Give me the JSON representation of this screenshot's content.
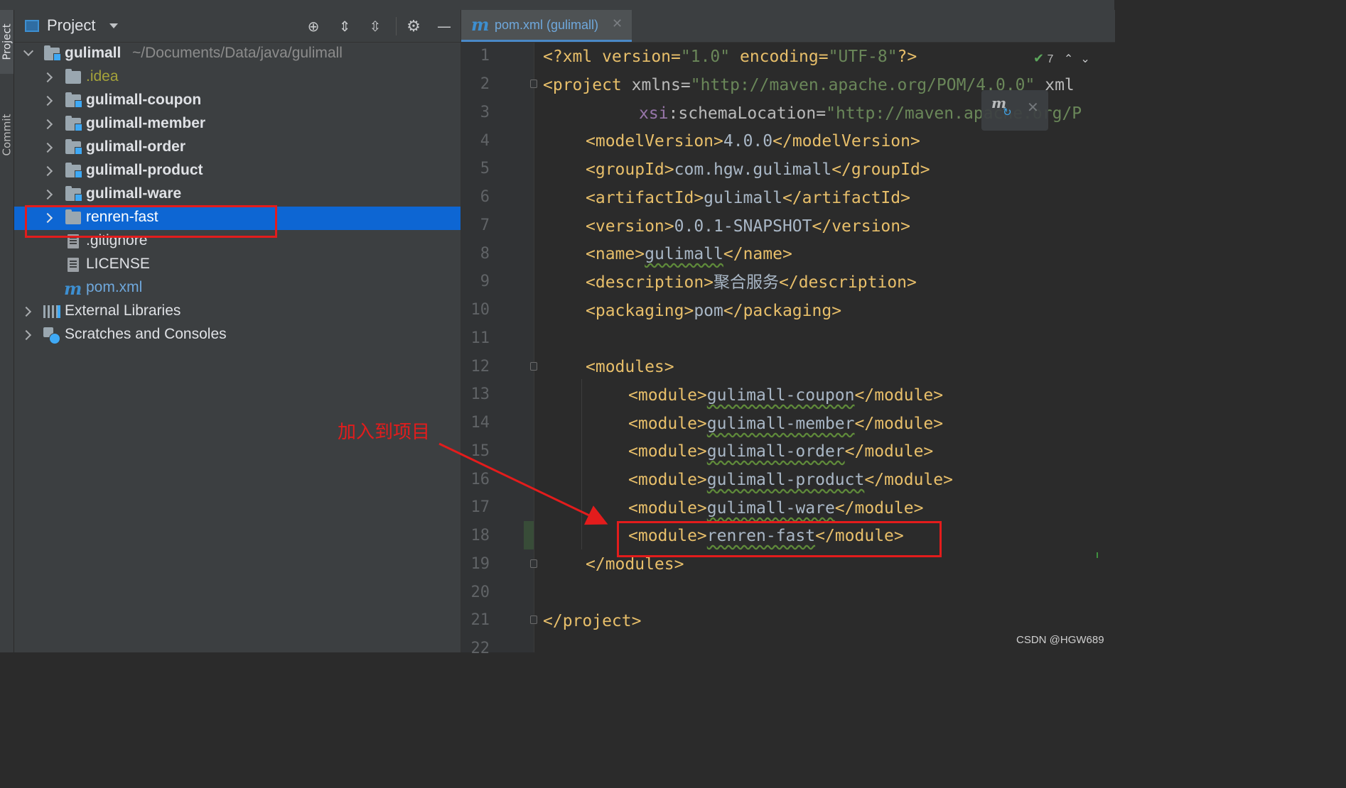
{
  "tool_stripe": {
    "project_tab": "Project",
    "commit_tab": "Commit"
  },
  "project_panel": {
    "title": "Project",
    "tree": [
      {
        "label": "gulimall",
        "path": "~/Documents/Data/java/gulimall"
      },
      {
        "label": ".idea"
      },
      {
        "label": "gulimall-coupon"
      },
      {
        "label": "gulimall-member"
      },
      {
        "label": "gulimall-order"
      },
      {
        "label": "gulimall-product"
      },
      {
        "label": "gulimall-ware"
      },
      {
        "label": "renren-fast"
      },
      {
        "label": ".gitignore"
      },
      {
        "label": "LICENSE"
      },
      {
        "label": "pom.xml"
      },
      {
        "label": "External Libraries"
      },
      {
        "label": "Scratches and Consoles"
      }
    ]
  },
  "editor": {
    "tab": {
      "icon_text": "m",
      "label": "pom.xml (gulimall)"
    },
    "inspection_count": "7",
    "line_numbers": [
      "1",
      "2",
      "3",
      "4",
      "5",
      "6",
      "7",
      "8",
      "9",
      "10",
      "11",
      "12",
      "13",
      "14",
      "15",
      "16",
      "17",
      "18",
      "19",
      "20",
      "21",
      "22"
    ],
    "code": {
      "l1_a": "<?xml version=",
      "l1_b": "\"1.0\"",
      "l1_c": " encoding=",
      "l1_d": "\"UTF-8\"",
      "l1_e": "?>",
      "l2_a": "<project ",
      "l2_b": "xmlns=",
      "l2_c": "\"http://maven.apache.org/POM/4.0.0\"",
      "l2_d": " xml",
      "l3_a": "xsi",
      "l3_b": ":schemaLocation=",
      "l3_c": "\"http://maven.apache.org/P",
      "l4_a": "<modelVersion>",
      "l4_b": "4.0.0",
      "l4_c": "</modelVersion>",
      "l5_a": "<groupId>",
      "l5_b": "com.hgw.gulimall",
      "l5_c": "</groupId>",
      "l6_a": "<artifactId>",
      "l6_b": "gulimall",
      "l6_c": "</artifactId>",
      "l7_a": "<version>",
      "l7_b": "0.0.1-SNAPSHOT",
      "l7_c": "</version>",
      "l8_a": "<name>",
      "l8_b": "gulimall",
      "l8_c": "</name>",
      "l9_a": "<description>",
      "l9_b": "聚合服务",
      "l9_c": "</description>",
      "l10_a": "<packaging>",
      "l10_b": "pom",
      "l10_c": "</packaging>",
      "l12": "<modules>",
      "l13_a": "<module>",
      "l13_b": "gulimall-coupon",
      "l13_c": "</module>",
      "l14_a": "<module>",
      "l14_b": "gulimall-member",
      "l14_c": "</module>",
      "l15_a": "<module>",
      "l15_b": "gulimall-order",
      "l15_c": "</module>",
      "l16_a": "<module>",
      "l16_b": "gulimall-product",
      "l16_c": "</module>",
      "l17_a": "<module>",
      "l17_b": "gulimall-ware",
      "l17_c": "</module>",
      "l18_a": "<module>",
      "l18_b": "renren-fast",
      "l18_c": "</module>",
      "l19": "</modules>",
      "l21": "</project>"
    },
    "maven_popup_icon": "m"
  },
  "annotation": {
    "text": "加入到项目",
    "color": "#e31c1c"
  },
  "watermark": "CSDN @HGW689",
  "colors": {
    "selection": "#0d66d3",
    "tag": "#e8bf6a",
    "string": "#6a8759",
    "text": "#a9b7c6",
    "accent": "#3d8fd1"
  }
}
